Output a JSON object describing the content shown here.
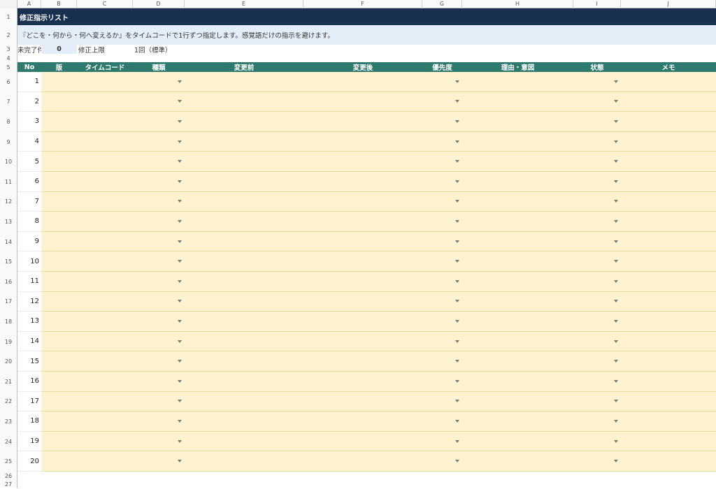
{
  "columns": [
    "A",
    "B",
    "C",
    "D",
    "E",
    "F",
    "G",
    "H",
    "I",
    "J"
  ],
  "title": "修正指示リスト",
  "description": "『どこを・何から・何へ変えるか』をタイムコードで1行ずつ指定します。感覚語だけの指示を避けます。",
  "summary": {
    "incomplete_label": "未完了件",
    "incomplete_value": "0",
    "limit_label": "修正上限",
    "limit_value": "1回（標準）"
  },
  "table": {
    "headers": [
      "No",
      "版",
      "タイムコード",
      "種類",
      "変更前",
      "変更後",
      "優先度",
      "理由・意図",
      "状態",
      "メモ"
    ],
    "rows": [
      "1",
      "2",
      "3",
      "4",
      "5",
      "6",
      "7",
      "8",
      "9",
      "10",
      "11",
      "12",
      "13",
      "14",
      "15",
      "16",
      "17",
      "18",
      "19",
      "20"
    ]
  },
  "row_numbers": [
    "1",
    "2",
    "3",
    "4",
    "5",
    "6",
    "7",
    "8",
    "9",
    "10",
    "11",
    "12",
    "13",
    "14",
    "15",
    "16",
    "17",
    "18",
    "19",
    "20",
    "21",
    "22",
    "23",
    "24",
    "25",
    "26",
    "27"
  ],
  "colors": {
    "title_bg": "#1a3050",
    "header_bg": "#2f7a6f",
    "input_bg": "#fdf3cf",
    "desc_bg": "#e3eef9"
  }
}
